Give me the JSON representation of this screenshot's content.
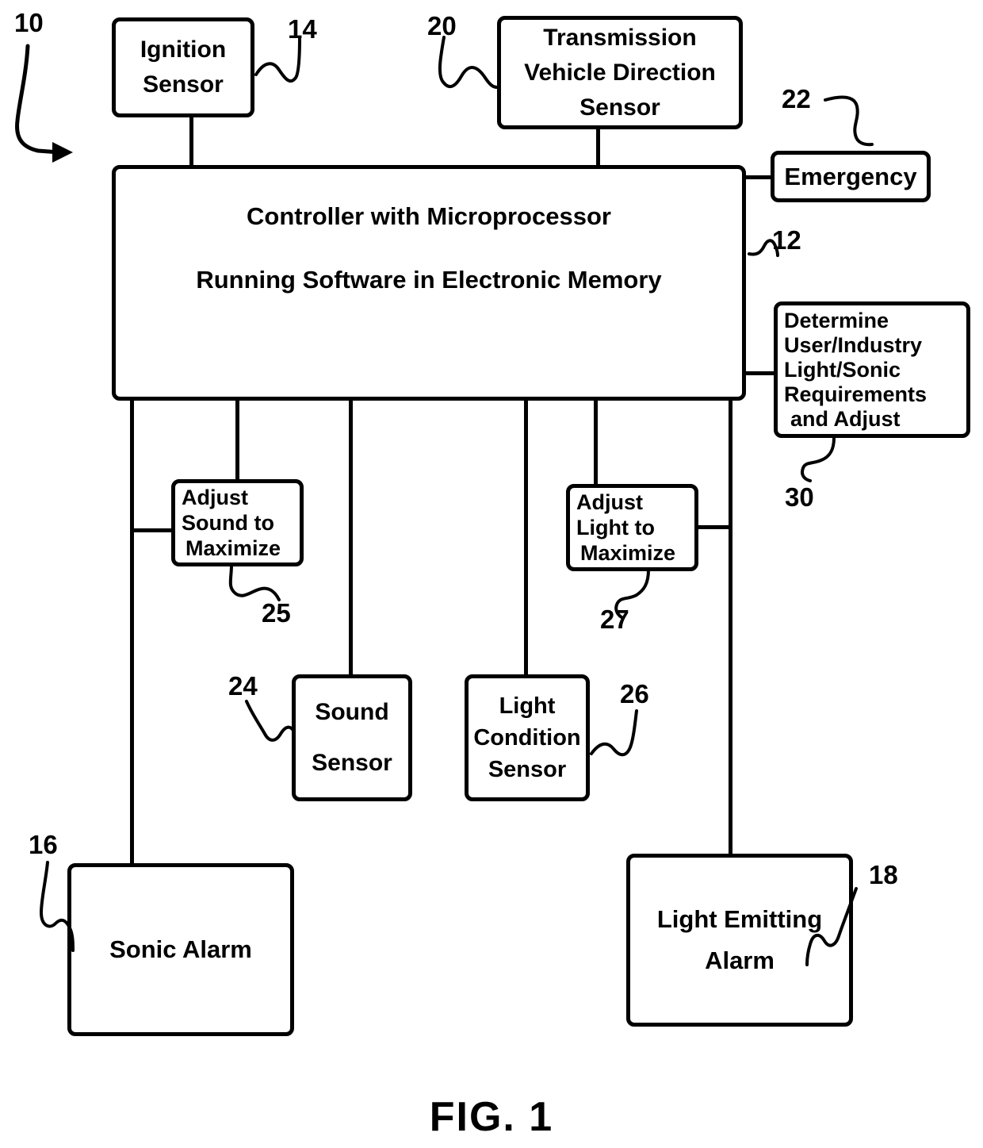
{
  "figure": {
    "caption": "FIG.  1",
    "overall_ref": "10"
  },
  "blocks": {
    "ignition_sensor": {
      "line1": "Ignition",
      "line2": "Sensor",
      "ref": "14"
    },
    "transmission_sensor": {
      "line1": "Transmission",
      "line2": "Vehicle Direction",
      "line3": "Sensor",
      "ref": "20"
    },
    "emergency": {
      "line1": "Emergency",
      "ref": "22"
    },
    "controller": {
      "line1": "Controller with Microprocessor",
      "line2": "Running Software in Electronic Memory",
      "ref": "12"
    },
    "determine_requirements": {
      "line1": "Determine",
      "line2": "User/Industry",
      "line3": "Light/Sonic",
      "line4": "Requirements",
      "line5": "and Adjust",
      "ref": "30"
    },
    "adjust_sound": {
      "line1": "Adjust",
      "line2": "Sound to",
      "line3": "Maximize",
      "ref": "25"
    },
    "adjust_light": {
      "line1": "Adjust",
      "line2": "Light to",
      "line3": "Maximize",
      "ref": "27"
    },
    "sound_sensor": {
      "line1": "Sound",
      "line2": "Sensor",
      "ref": "24"
    },
    "light_condition_sensor": {
      "line1": "Light",
      "line2": "Condition",
      "line3": "Sensor",
      "ref": "26"
    },
    "sonic_alarm": {
      "line1": "Sonic Alarm",
      "ref": "16"
    },
    "light_emitting_alarm": {
      "line1": "Light Emitting",
      "line2": "Alarm",
      "ref": "18"
    }
  },
  "style": {
    "stroke": "#000000",
    "background": "#ffffff"
  }
}
